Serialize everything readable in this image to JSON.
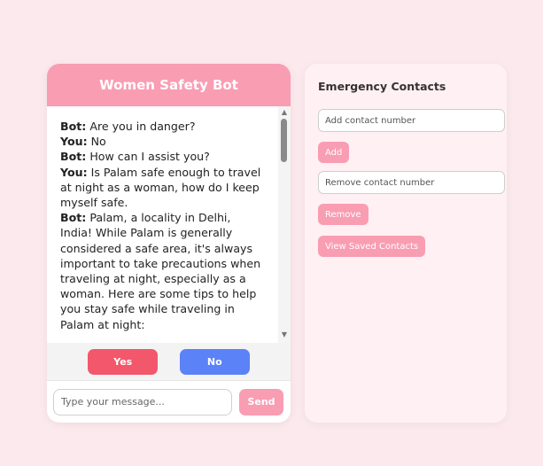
{
  "chat": {
    "title": "Women Safety Bot",
    "messages": [
      {
        "sender": "Bot:",
        "text": "Are you in danger?"
      },
      {
        "sender": "You:",
        "text": "No"
      },
      {
        "sender": "Bot:",
        "text": "How can I assist you?"
      },
      {
        "sender": "You:",
        "text": "Is Palam safe enough to travel at night as a woman, how do I keep myself safe."
      },
      {
        "sender": "Bot:",
        "text": "Palam, a locality in Delhi, India! While Palam is generally considered a safe area, it's always important to take precautions when traveling at night, especially as a woman. Here are some tips to help you stay safe while traveling in Palam at night:"
      }
    ],
    "yes_label": "Yes",
    "no_label": "No",
    "input_placeholder": "Type your message...",
    "send_label": "Send"
  },
  "contacts": {
    "title": "Emergency Contacts",
    "add_placeholder": "Add contact number",
    "add_label": "Add",
    "remove_placeholder": "Remove contact number",
    "remove_label": "Remove",
    "view_label": "View Saved Contacts"
  },
  "colors": {
    "accent_pink": "#f99db3",
    "yes_red": "#f2576b",
    "no_blue": "#5b82f7",
    "page_bg": "#fbe9ee"
  }
}
